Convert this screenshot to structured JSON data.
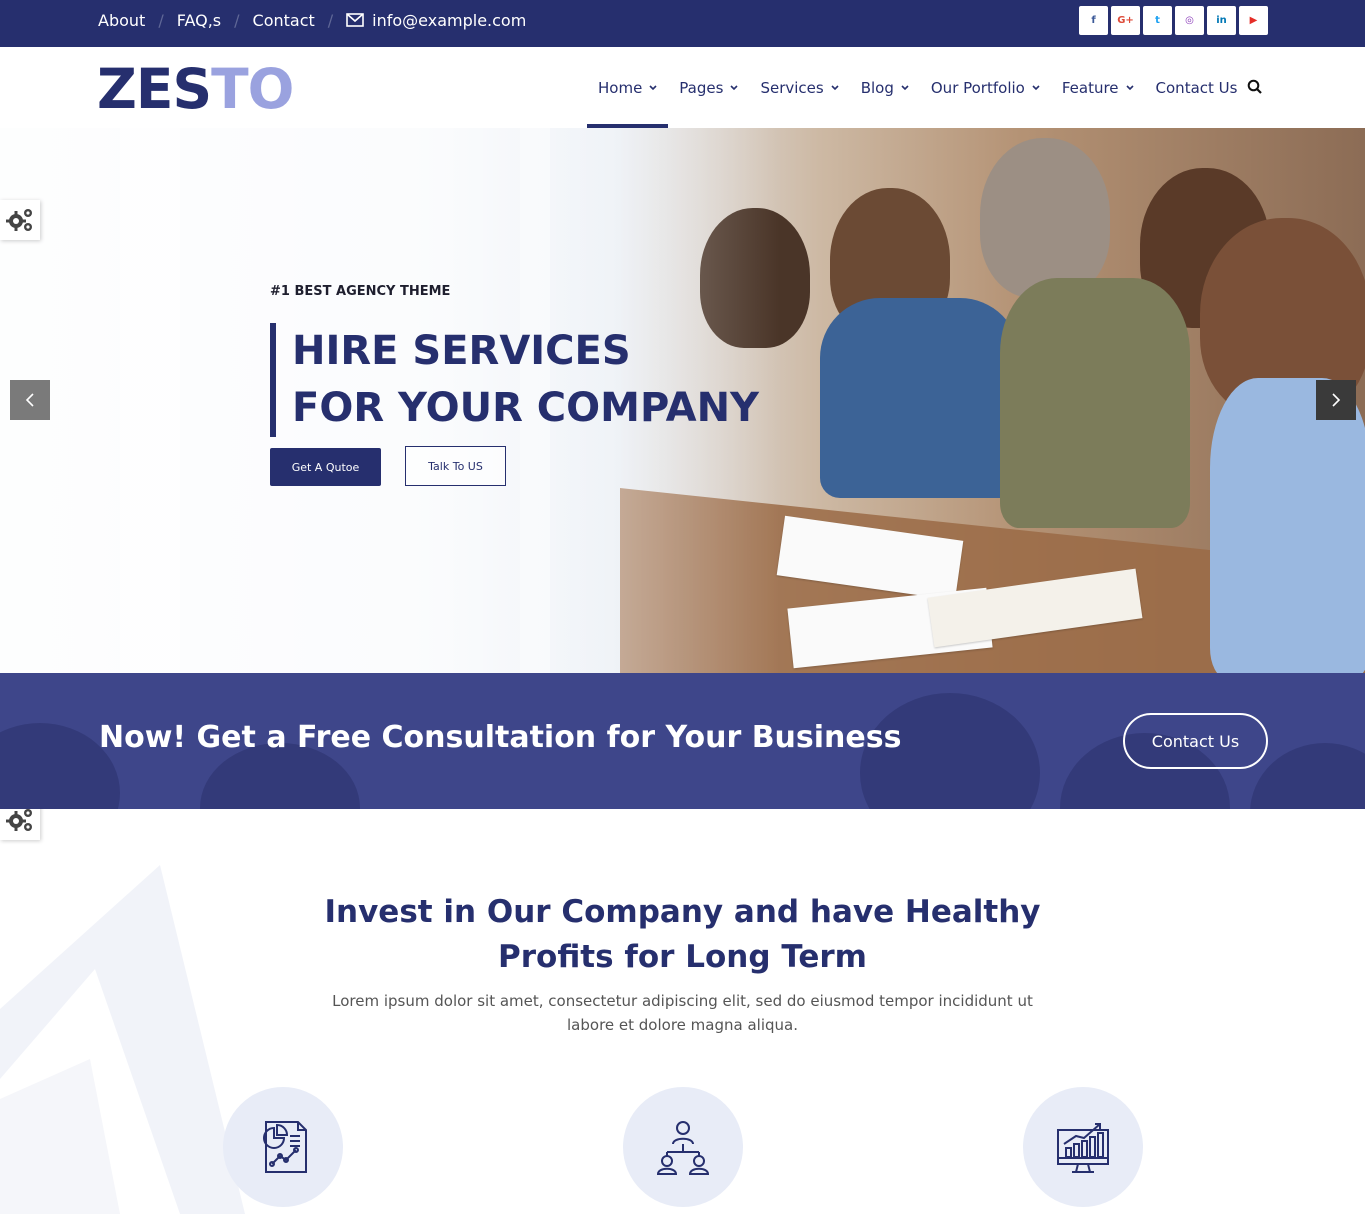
{
  "topbar": {
    "links": [
      "About",
      "FAQ,s",
      "Contact"
    ],
    "email": "info@example.com",
    "social": [
      {
        "icon": "facebook-icon",
        "glyph": "f",
        "color": "#3b5998"
      },
      {
        "icon": "google-plus-icon",
        "glyph": "G+",
        "color": "#dd4b39"
      },
      {
        "icon": "twitter-icon",
        "glyph": "t",
        "color": "#1da1f2"
      },
      {
        "icon": "instagram-icon",
        "glyph": "◎",
        "color": "#8a3ab9"
      },
      {
        "icon": "linkedin-icon",
        "glyph": "in",
        "color": "#0077b5"
      },
      {
        "icon": "youtube-icon",
        "glyph": "▶",
        "color": "#e52d27"
      }
    ]
  },
  "header": {
    "logo_dark": "ZES",
    "logo_light": "TO",
    "nav": [
      "Home",
      "Pages",
      "Services",
      "Blog",
      "Our Portfolio",
      "Feature",
      "Contact Us"
    ],
    "active_nav": "Home"
  },
  "hero": {
    "tagline": "#1 BEST AGENCY THEME",
    "title_line1": "HIRE SERVICES",
    "title_line2": "FOR YOUR COMPANY",
    "primary_button": "Get A Qutoe",
    "secondary_button": "Talk To US"
  },
  "cta": {
    "text": "Now! Get a Free Consultation for Your Business",
    "button": "Contact Us"
  },
  "invest": {
    "title_line1": "Invest in Our Company and have Healthy",
    "title_line2": "Profits for Long Term",
    "text_line1": "Lorem ipsum dolor sit amet, consectetur adipiscing elit, sed do eiusmod tempor incididunt ut",
    "text_line2": "labore et dolore magna aliqua.",
    "features": [
      {
        "icon": "report-chart-icon"
      },
      {
        "icon": "team-hierarchy-icon"
      },
      {
        "icon": "growth-monitor-icon"
      }
    ]
  },
  "colors": {
    "primary": "#262f6e",
    "accent_light": "#9aa2df",
    "cta_band": "#3e468a"
  }
}
